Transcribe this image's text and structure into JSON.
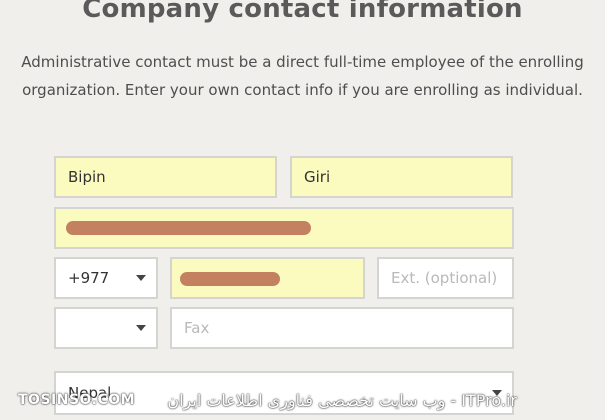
{
  "form": {
    "title": "Company contact information",
    "description": "Administrative contact must be a direct full-time employee of the enrolling organization. Enter your own contact info if you are enrolling as individual.",
    "first_name": "Bipin",
    "last_name": "Giri",
    "email": "",
    "phone_country_code": "+977",
    "phone": "",
    "ext_placeholder": "Ext. (optional)",
    "fax_country_code": "",
    "fax_placeholder": "Fax",
    "country": "Nepal"
  },
  "watermark": {
    "left": "TOSINSO.COM",
    "right": "ITPro.ir - وب سایت تخصصی فناوری اطلاعات ایران"
  },
  "colors": {
    "background": "#f1efeb",
    "autofill": "#fbfbc0",
    "border": "#d4d4d0"
  }
}
